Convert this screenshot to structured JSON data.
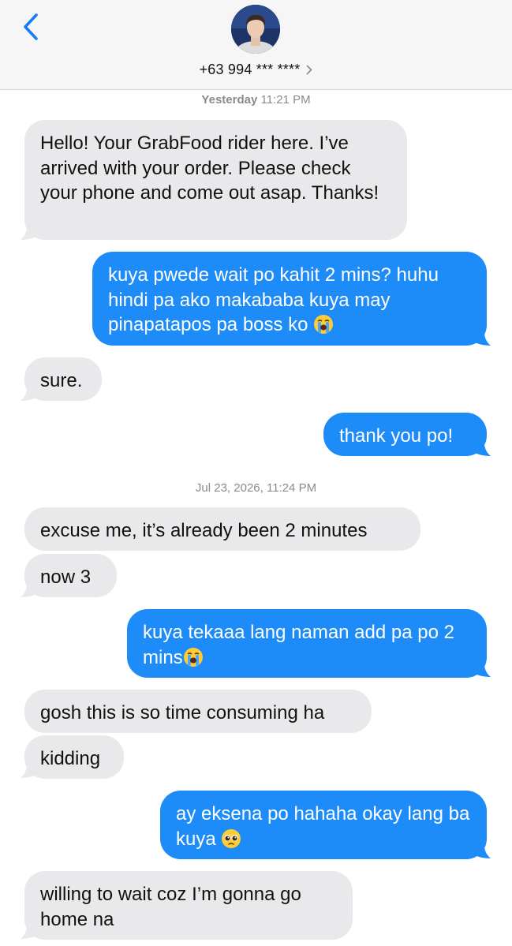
{
  "header": {
    "contact_name": "+63 994 *** ****"
  },
  "thread": {
    "stamp1_day": "Yesterday",
    "stamp1_time": " 11:21 PM",
    "stamp2": "Jul 23, 2026, 11:24 PM",
    "messages": [
      {
        "from": "them",
        "text": "Hello! Your GrabFood rider here. I’ve arrived with your order. Please check your phone and come out asap. Thanks!"
      },
      {
        "from": "me",
        "text": "kuya pwede wait po kahit 2 mins? huhu hindi pa ako makababa kuya may pinapatapos pa boss ko",
        "emoji": "loudly-crying-face"
      },
      {
        "from": "them",
        "text": "sure."
      },
      {
        "from": "me",
        "text": "thank you po!"
      },
      {
        "from": "them",
        "text": "excuse me, it’s already been 2 minutes"
      },
      {
        "from": "them",
        "text": "now 3"
      },
      {
        "from": "me",
        "text": "kuya tekaaa lang naman add pa po 2 mins",
        "emoji": "loudly-crying-face"
      },
      {
        "from": "them",
        "text": "gosh this is so time consuming ha"
      },
      {
        "from": "them",
        "text": "kidding"
      },
      {
        "from": "me",
        "text": "ay eksena po hahaha okay lang ba kuya",
        "emoji": "pleading-face"
      },
      {
        "from": "them",
        "text": "willing to wait coz I’m gonna go home na"
      }
    ]
  },
  "colors": {
    "incoming_bubble": "#e9e9eb",
    "outgoing_bubble": "#1e8cf8",
    "accent": "#1a7cf5",
    "timestamp": "#8a8a8e"
  }
}
